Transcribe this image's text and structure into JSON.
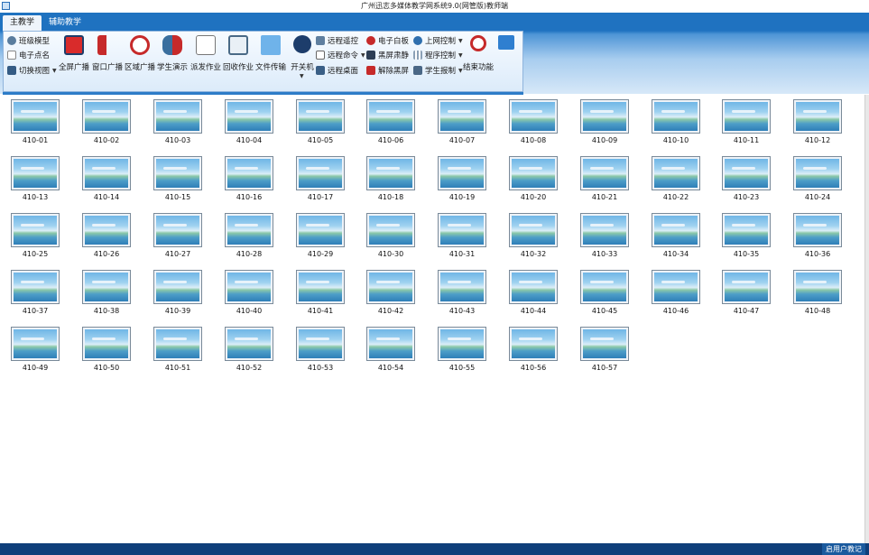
{
  "window": {
    "title": "广州迅志多媒体教学网系统9.0(网管版)教师端"
  },
  "tabs": [
    {
      "label": "主教学"
    },
    {
      "label": "辅助教学"
    }
  ],
  "ribbon": {
    "left": {
      "class_model": "班级模型",
      "roll_call": "电子点名",
      "switch_view": "切换视图"
    },
    "big": {
      "fullscreen": "全屏广播",
      "window": "窗口广播",
      "area": "区域广播",
      "student_demo": "学生演示",
      "send_work": "派发作业",
      "collect_work": "回收作业",
      "file_transfer": "文件传输",
      "power": "开关机"
    },
    "right": {
      "remote_monitor": "远程遥控",
      "remote_cmd": "远程命令",
      "remote_desktop": "远程桌面",
      "whiteboard": "电子白板",
      "black_screen": "黑屏肃静",
      "unlock_black": "解除黑屏",
      "net_control": "上网控制",
      "program_control": "程序控制",
      "student_exit": "学生报制",
      "end_function": "结束功能"
    }
  },
  "computers": [
    "410-01",
    "410-02",
    "410-03",
    "410-04",
    "410-05",
    "410-06",
    "410-07",
    "410-08",
    "410-09",
    "410-10",
    "410-11",
    "410-12",
    "410-13",
    "410-14",
    "410-15",
    "410-16",
    "410-17",
    "410-18",
    "410-19",
    "410-20",
    "410-21",
    "410-22",
    "410-23",
    "410-24",
    "410-25",
    "410-26",
    "410-27",
    "410-28",
    "410-29",
    "410-30",
    "410-31",
    "410-32",
    "410-33",
    "410-34",
    "410-35",
    "410-36",
    "410-37",
    "410-38",
    "410-39",
    "410-40",
    "410-41",
    "410-42",
    "410-43",
    "410-44",
    "410-45",
    "410-46",
    "410-47",
    "410-48",
    "410-49",
    "410-50",
    "410-51",
    "410-52",
    "410-53",
    "410-54",
    "410-55",
    "410-56",
    "410-57"
  ],
  "status": {
    "text": "启用户教记"
  },
  "colors": {
    "accent": "#1f72c0",
    "status_bar": "#0f3f7a"
  }
}
